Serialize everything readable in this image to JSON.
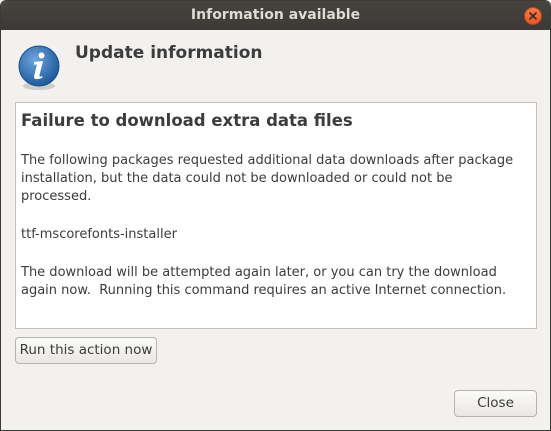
{
  "window": {
    "title": "Information available"
  },
  "header": {
    "icon": "info-icon",
    "title": "Update information"
  },
  "message": {
    "title": "Failure to download extra data files",
    "paragraphs": [
      "The following packages requested additional data downloads after package\ninstallation, but the data could not be downloaded or could not be\nprocessed.",
      "ttf-mscorefonts-installer",
      "The download will be attempted again later, or you can try the download\nagain now.  Running this command requires an active Internet connection."
    ]
  },
  "buttons": {
    "run_action": "Run this action now",
    "close": "Close"
  },
  "colors": {
    "titlebar": "#3b3a36",
    "close_button": "#e8602f",
    "info_icon": "#2f6fb0"
  }
}
